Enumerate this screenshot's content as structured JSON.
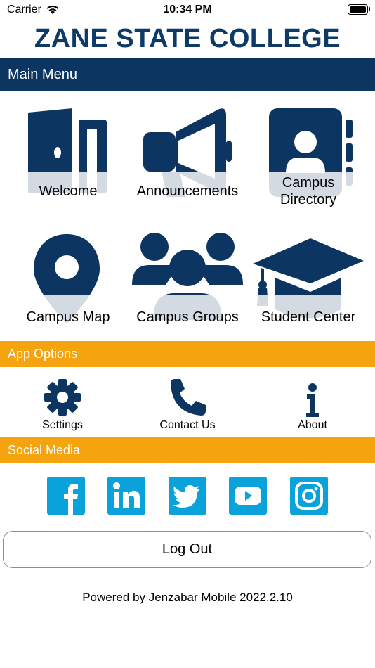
{
  "status": {
    "carrier": "Carrier",
    "time": "10:34 PM"
  },
  "header": {
    "title": "ZANE STATE COLLEGE"
  },
  "sections": {
    "main": "Main Menu",
    "options": "App Options",
    "social": "Social Media"
  },
  "main_menu": {
    "welcome": "Welcome",
    "announcements": "Announcements",
    "directory_line1": "Campus",
    "directory_line2": "Directory",
    "map": "Campus Map",
    "groups": "Campus Groups",
    "student_center": "Student Center"
  },
  "options": {
    "settings": "Settings",
    "contact": "Contact Us",
    "about": "About"
  },
  "social": [
    "facebook-icon",
    "linkedin-icon",
    "twitter-icon",
    "youtube-icon",
    "instagram-icon"
  ],
  "logout_label": "Log Out",
  "footer": {
    "powered_by": "Powered by Jenzabar Mobile 2022.2.10"
  },
  "colors": {
    "navy": "#0c3562",
    "orange": "#f5a30e",
    "social_blue": "#0aa2db",
    "faded": "#d6dbe2"
  }
}
